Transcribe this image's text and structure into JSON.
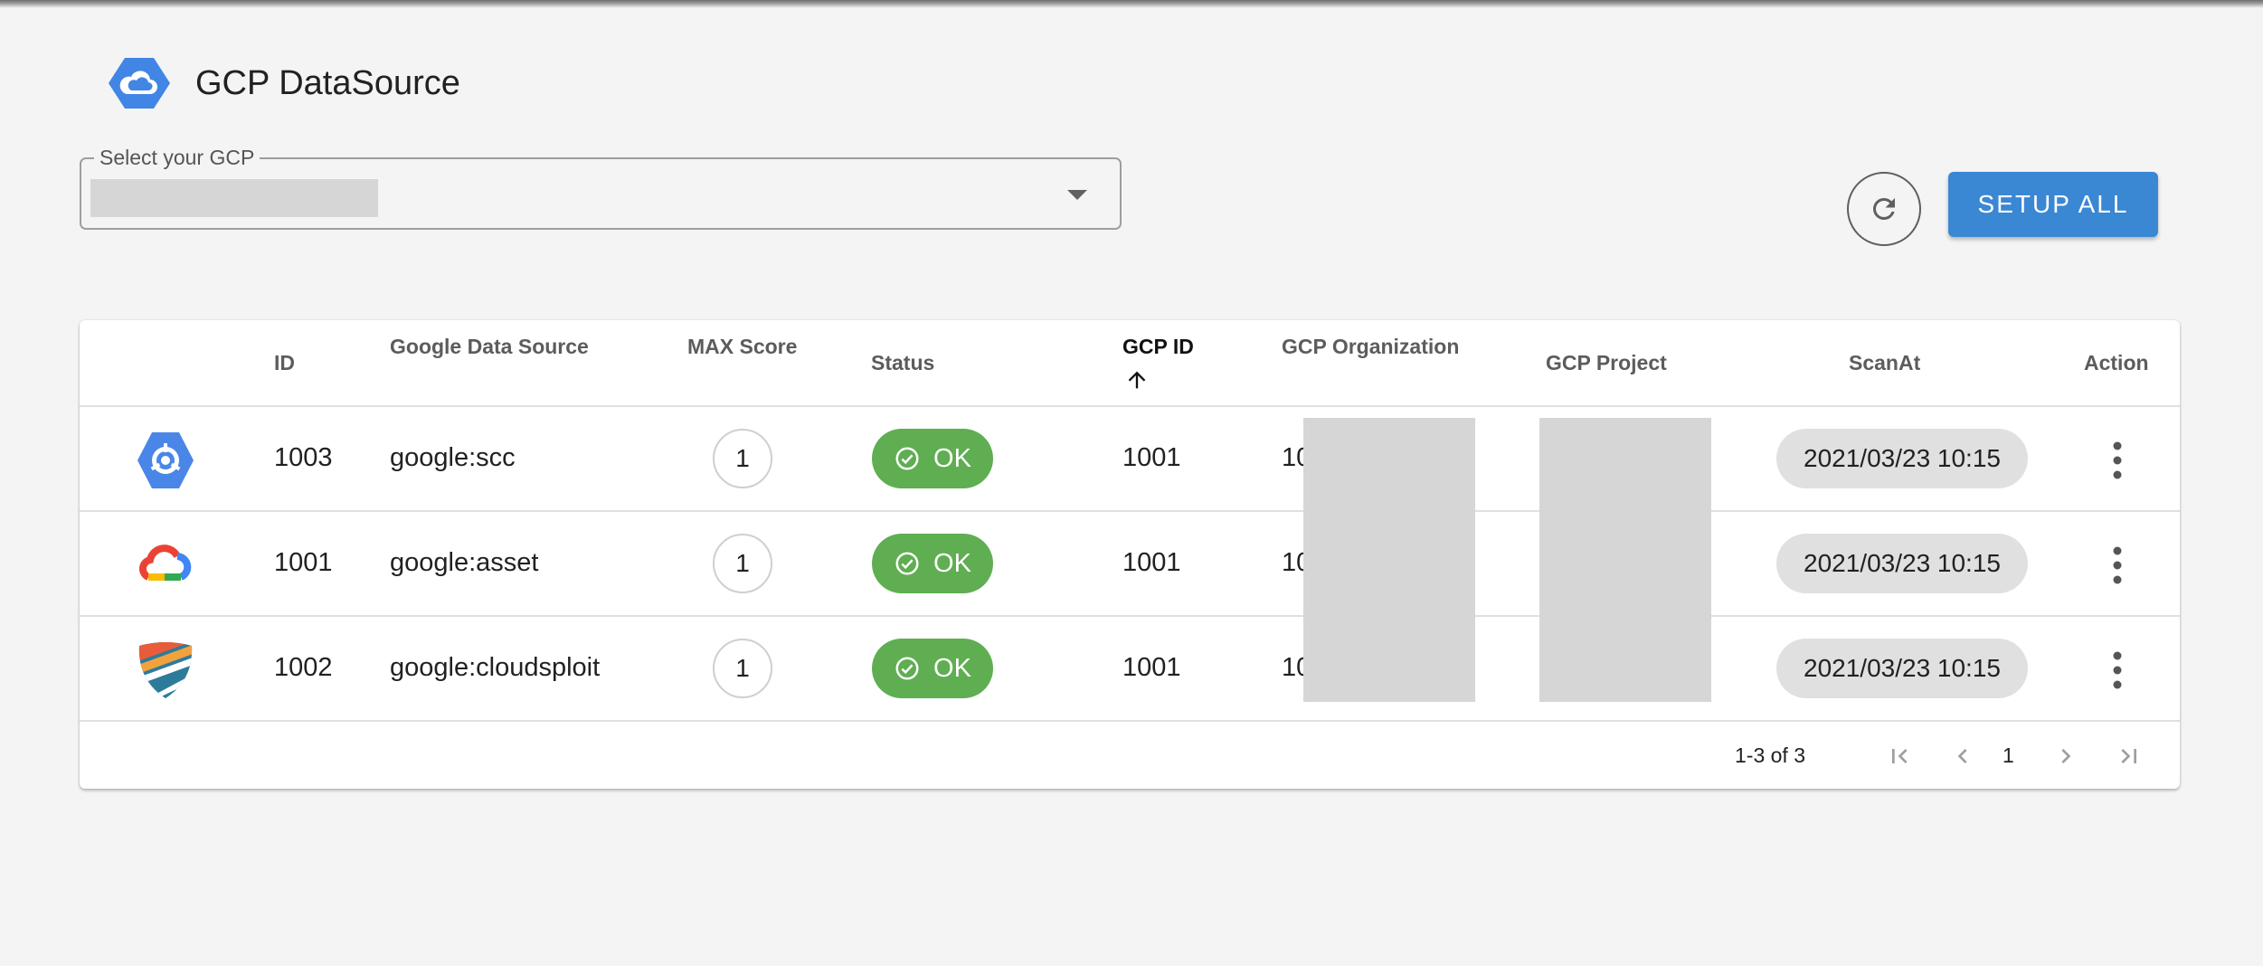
{
  "header": {
    "title": "GCP DataSource"
  },
  "select": {
    "label": "Select your GCP",
    "value": ""
  },
  "actions": {
    "setup_all": "SETUP ALL"
  },
  "table": {
    "columns": [
      "ID",
      "Google Data Source",
      "MAX Score",
      "Status",
      "GCP ID",
      "GCP Organization",
      "GCP Project",
      "ScanAt",
      "Action"
    ],
    "sorted_column": "GCP ID",
    "sort_direction": "ascending",
    "rows": [
      {
        "icon": "security-command-center-icon",
        "id": "1003",
        "source": "google:scc",
        "max_score": "1",
        "status": "OK",
        "gcp_id": "1001",
        "org_prefix": "10",
        "scan_at": "2021/03/23 10:15"
      },
      {
        "icon": "google-cloud-icon",
        "id": "1001",
        "source": "google:asset",
        "max_score": "1",
        "status": "OK",
        "gcp_id": "1001",
        "org_prefix": "10",
        "scan_at": "2021/03/23 10:15"
      },
      {
        "icon": "cloudsploit-shield-icon",
        "id": "1002",
        "source": "google:cloudsploit",
        "max_score": "1",
        "status": "OK",
        "gcp_id": "1001",
        "org_prefix": "10",
        "scan_at": "2021/03/23 10:15"
      }
    ]
  },
  "pagination": {
    "range": "1-3 of 3",
    "page": "1"
  },
  "colors": {
    "primary": "#3a87d4",
    "status_ok": "#5fae52",
    "chip_grey": "#e0e0e0"
  }
}
